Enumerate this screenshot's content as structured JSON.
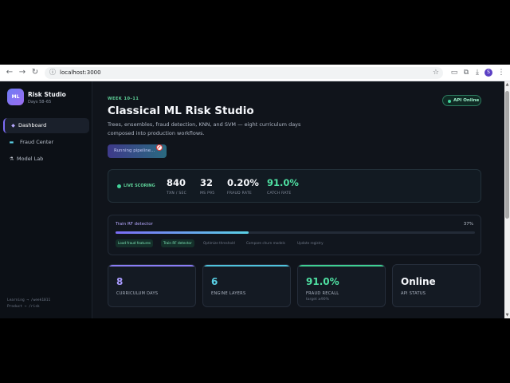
{
  "browser": {
    "url": "localhost:3000",
    "profile_initial": "S"
  },
  "sidebar": {
    "logo": "ML",
    "brand_name": "Risk Studio",
    "brand_sub": "Days 58–65",
    "items": [
      {
        "label": "Dashboard",
        "icon": "diamond-icon",
        "active": true
      },
      {
        "label": "Fraud Center",
        "icon": "card-icon",
        "active": false
      },
      {
        "label": "Model Lab",
        "icon": "flask-icon",
        "active": false
      }
    ],
    "footer": [
      "Learning → /week1011",
      "Product → /risk"
    ]
  },
  "header": {
    "eyebrow": "WEEK 10–11",
    "title": "Classical ML Risk Studio",
    "subtitle": "Trees, ensembles, fraud detection, KNN, and SVM — eight curriculum days composed into production workflows.",
    "pipeline_button": "Running pipeline...",
    "api_status": "API Online"
  },
  "scoring": {
    "label": "LIVE SCORING",
    "metrics": [
      {
        "value": "840",
        "label": "TXN / SEC"
      },
      {
        "value": "32",
        "label": "MS P95"
      },
      {
        "value": "0.20%",
        "label": "FRAUD RATE"
      },
      {
        "value": "91.0%",
        "label": "CATCH RATE"
      }
    ]
  },
  "progress": {
    "title": "Train RF detector",
    "percent_text": "37%",
    "percent": 0.37,
    "steps": [
      {
        "label": "Load fraud features",
        "done": true
      },
      {
        "label": "Train RF detector",
        "done": true
      },
      {
        "label": "Optimize threshold",
        "done": false
      },
      {
        "label": "Compare churn models",
        "done": false
      },
      {
        "label": "Update registry",
        "done": false
      }
    ]
  },
  "stats": [
    {
      "value": "8",
      "label": "CURRICULUM DAYS",
      "sub": "",
      "color": "#a99bff",
      "bar": "#8a7cf5"
    },
    {
      "value": "6",
      "label": "ENGINE LAYERS",
      "sub": "",
      "color": "#5ad1e6",
      "bar": "#4fc3dc"
    },
    {
      "value": "91.0%",
      "label": "FRAUD RECALL",
      "sub": "target ≥90%",
      "color": "#4fe0a2",
      "bar": "#3fcf92"
    },
    {
      "value": "Online",
      "label": "API STATUS",
      "sub": "",
      "color": "#f5f7fb",
      "bar": "transparent"
    }
  ]
}
